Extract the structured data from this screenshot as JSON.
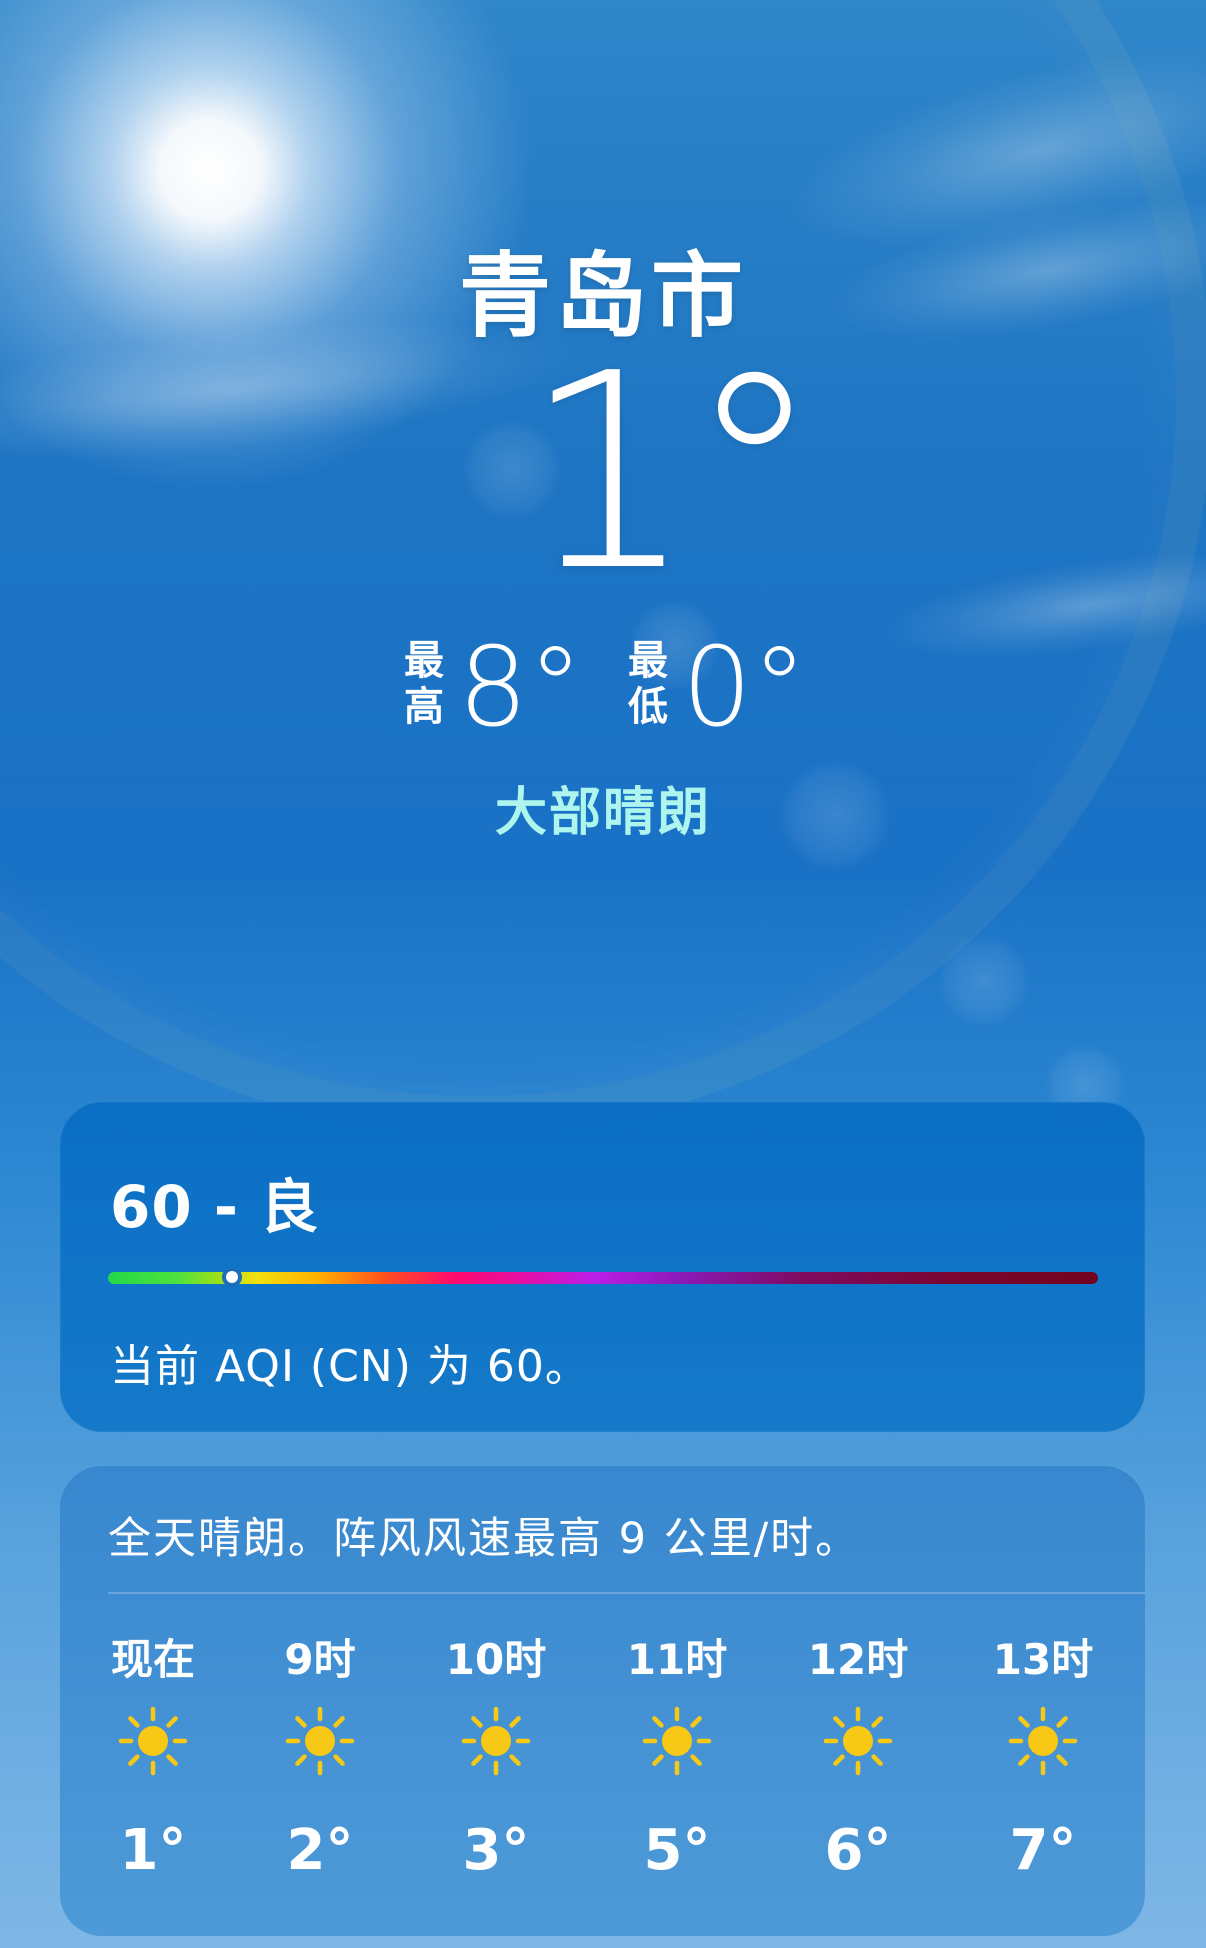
{
  "location": {
    "city": "青岛市",
    "temperature": "1°",
    "high_label_top": "最",
    "high_label_bottom": "高",
    "high": "8°",
    "low_label_top": "最",
    "low_label_bottom": "低",
    "low": "0°",
    "condition": "大部晴朗"
  },
  "aqi": {
    "title": "60 - 良",
    "value": 60,
    "marker_fraction": 0.125,
    "description": "当前 AQI (CN) 为 60。",
    "scale_colors": [
      "#22d84a",
      "#f3e00d",
      "#ff4f1d",
      "#ff0a6e",
      "#bb1ee8",
      "#7f0b62",
      "#72031f"
    ]
  },
  "forecast": {
    "summary": "全天晴朗。阵风风速最高 9 公里/时。",
    "hours": [
      {
        "label": "现在",
        "icon": "sun-icon",
        "temp": "1°"
      },
      {
        "label": "9时",
        "icon": "sun-icon",
        "temp": "2°"
      },
      {
        "label": "10时",
        "icon": "sun-icon",
        "temp": "3°"
      },
      {
        "label": "11时",
        "icon": "sun-icon",
        "temp": "5°"
      },
      {
        "label": "12时",
        "icon": "sun-icon",
        "temp": "6°"
      },
      {
        "label": "13时",
        "icon": "sun-icon",
        "temp": "7°"
      }
    ],
    "sun_color": "#f7c916"
  },
  "colors": {
    "condition_text": "#aef5ee",
    "sky_top": "#2f86c9",
    "sky_bottom": "#7fb7e6"
  }
}
